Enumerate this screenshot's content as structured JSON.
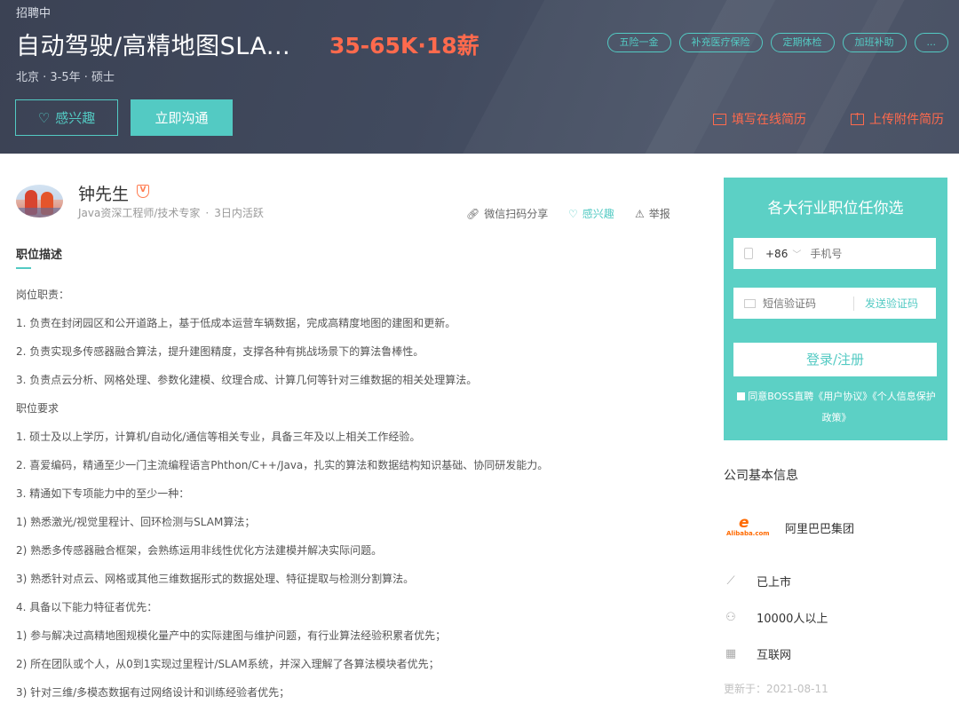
{
  "header": {
    "status": "招聘中",
    "job_title": "自动驾驶/高精地图SLA...",
    "salary": "35-65K·18薪",
    "meta": "北京 · 3-5年 · 硕士",
    "tags": [
      "五险一金",
      "补充医疗保险",
      "定期体检",
      "加班补助",
      "..."
    ],
    "interest_label": "感兴趣",
    "chat_label": "立即沟通",
    "online_resume_label": "填写在线简历",
    "upload_resume_label": "上传附件简历"
  },
  "recruiter": {
    "name": "钟先生",
    "title": "Java资深工程师/技术专家",
    "active": "3日内活跃",
    "share_label": "微信扫码分享",
    "like_label": "感兴趣",
    "report_label": "举报"
  },
  "description": {
    "section_title": "职位描述",
    "lines": [
      "岗位职责：",
      "1. 负责在封闭园区和公开道路上，基于低成本运营车辆数据，完成高精度地图的建图和更新。",
      "2. 负责实现多传感器融合算法，提升建图精度，支撑各种有挑战场景下的算法鲁棒性。",
      "3. 负责点云分析、网格处理、参数化建模、纹理合成、计算几何等针对三维数据的相关处理算法。",
      "职位要求",
      "1. 硕士及以上学历，计算机/自动化/通信等相关专业，具备三年及以上相关工作经验。",
      "2. 喜爱编码，精通至少一门主流编程语言Phthon/C++/Java，扎实的算法和数据结构知识基础、协同研发能力。",
      "3. 精通如下专项能力中的至少一种：",
      "1) 熟悉激光/视觉里程计、回环检测与SLAM算法；",
      "2) 熟悉多传感器融合框架，会熟练运用非线性优化方法建模并解决实际问题。",
      "3) 熟悉针对点云、网格或其他三维数据形式的数据处理、特征提取与检测分割算法。",
      "4. 具备以下能力特征者优先：",
      "1) 参与解决过高精地图规模化量产中的实际建图与维护问题，有行业算法经验积累者优先；",
      "2) 所在团队或个人，从0到1实现过里程计/SLAM系统，并深入理解了各算法模块者优先；",
      "3) 针对三维/多模态数据有过网络设计和训练经验者优先；"
    ]
  },
  "login": {
    "title": "各大行业职位任你选",
    "country_code": "+86",
    "phone_placeholder": "手机号",
    "sms_placeholder": "短信验证码",
    "send_code_label": "发送验证码",
    "submit_label": "登录/注册",
    "agreement": "同意BOSS直聘《用户协议》《个人信息保护政策》"
  },
  "company": {
    "heading": "公司基本信息",
    "logo_text": "Alibaba.com",
    "name": "阿里巴巴集团",
    "stage": "已上市",
    "size": "10000人以上",
    "industry": "互联网",
    "updated": "更新于：2021-08-11"
  },
  "colors": {
    "accent": "#53cac3",
    "salary": "#ff6a4d",
    "banner": "#414a5e"
  }
}
